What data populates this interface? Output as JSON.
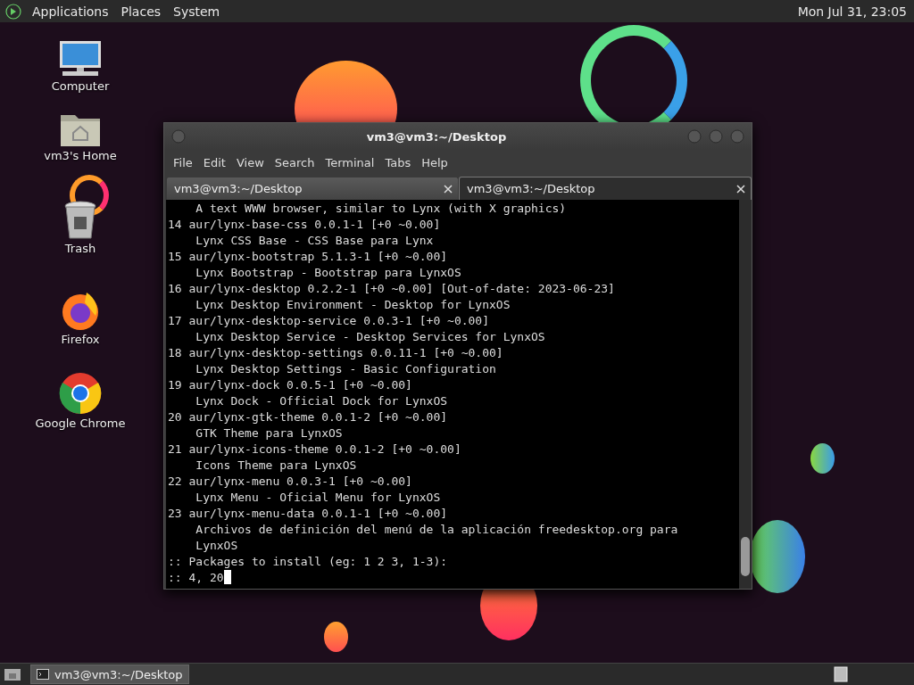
{
  "top_panel": {
    "menus": [
      "Applications",
      "Places",
      "System"
    ],
    "clock": "Mon Jul 31, 23:05"
  },
  "desktop_icons": [
    {
      "label": "Computer",
      "kind": "computer"
    },
    {
      "label": "vm3's Home",
      "kind": "home"
    },
    {
      "label": "Trash",
      "kind": "trash"
    },
    {
      "label": "Firefox",
      "kind": "firefox"
    },
    {
      "label": "Google Chrome",
      "kind": "chrome"
    }
  ],
  "terminal": {
    "title": "vm3@vm3:~/Desktop",
    "menu": [
      "File",
      "Edit",
      "View",
      "Search",
      "Terminal",
      "Tabs",
      "Help"
    ],
    "tabs": [
      {
        "label": "vm3@vm3:~/Desktop",
        "selected": false
      },
      {
        "label": "vm3@vm3:~/Desktop",
        "selected": true
      }
    ],
    "lines": [
      "    A text WWW browser, similar to Lynx (with X graphics)",
      "14 aur/lynx-base-css 0.0.1-1 [+0 ~0.00]",
      "    Lynx CSS Base - CSS Base para Lynx",
      "15 aur/lynx-bootstrap 5.1.3-1 [+0 ~0.00]",
      "    Lynx Bootstrap - Bootstrap para LynxOS",
      "16 aur/lynx-desktop 0.2.2-1 [+0 ~0.00] [Out-of-date: 2023-06-23]",
      "    Lynx Desktop Environment - Desktop for LynxOS",
      "17 aur/lynx-desktop-service 0.0.3-1 [+0 ~0.00]",
      "    Lynx Desktop Service - Desktop Services for LynxOS",
      "18 aur/lynx-desktop-settings 0.0.11-1 [+0 ~0.00]",
      "    Lynx Desktop Settings - Basic Configuration",
      "19 aur/lynx-dock 0.0.5-1 [+0 ~0.00]",
      "    Lynx Dock - Official Dock for LynxOS",
      "20 aur/lynx-gtk-theme 0.0.1-2 [+0 ~0.00]",
      "    GTK Theme para LynxOS",
      "21 aur/lynx-icons-theme 0.0.1-2 [+0 ~0.00]",
      "    Icons Theme para LynxOS",
      "22 aur/lynx-menu 0.0.3-1 [+0 ~0.00]",
      "    Lynx Menu - Oficial Menu for LynxOS",
      "23 aur/lynx-menu-data 0.0.1-1 [+0 ~0.00]",
      "    Archivos de definición del menú de la aplicación freedesktop.org para",
      "    LynxOS",
      ":: Packages to install (eg: 1 2 3, 1-3):",
      ":: 4, 20"
    ]
  },
  "taskbar": {
    "tasks": [
      "vm3@vm3:~/Desktop"
    ]
  }
}
